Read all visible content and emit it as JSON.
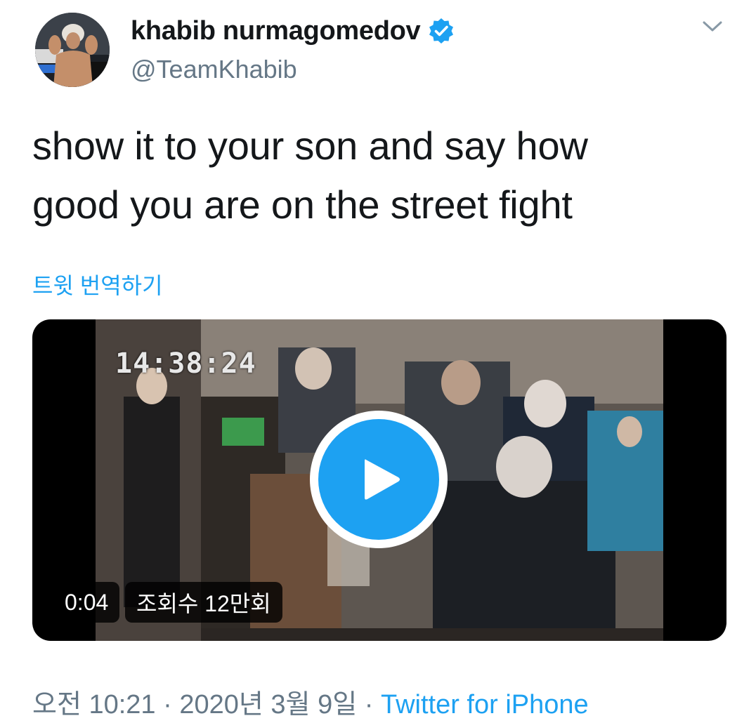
{
  "author": {
    "display_name": "khabib nurmagomedov",
    "handle": "@TeamKhabib",
    "verified": true,
    "avatar_icon": "profile-photo"
  },
  "tweet": {
    "text_line1": "show it to your son and say how",
    "text_line2": "good you are on the street fight",
    "translate_label": "트윗 번역하기"
  },
  "media": {
    "camera_timestamp": "14:38:24",
    "duration": "0:04",
    "views": "조회수 12만회",
    "play_icon": "play-icon"
  },
  "meta": {
    "time": "오전 10:21",
    "separator": " · ",
    "date": "2020년 3월 9일",
    "source": "Twitter for iPhone"
  },
  "colors": {
    "accent": "#1da1f2",
    "text": "#14171a",
    "secondary": "#657786"
  }
}
